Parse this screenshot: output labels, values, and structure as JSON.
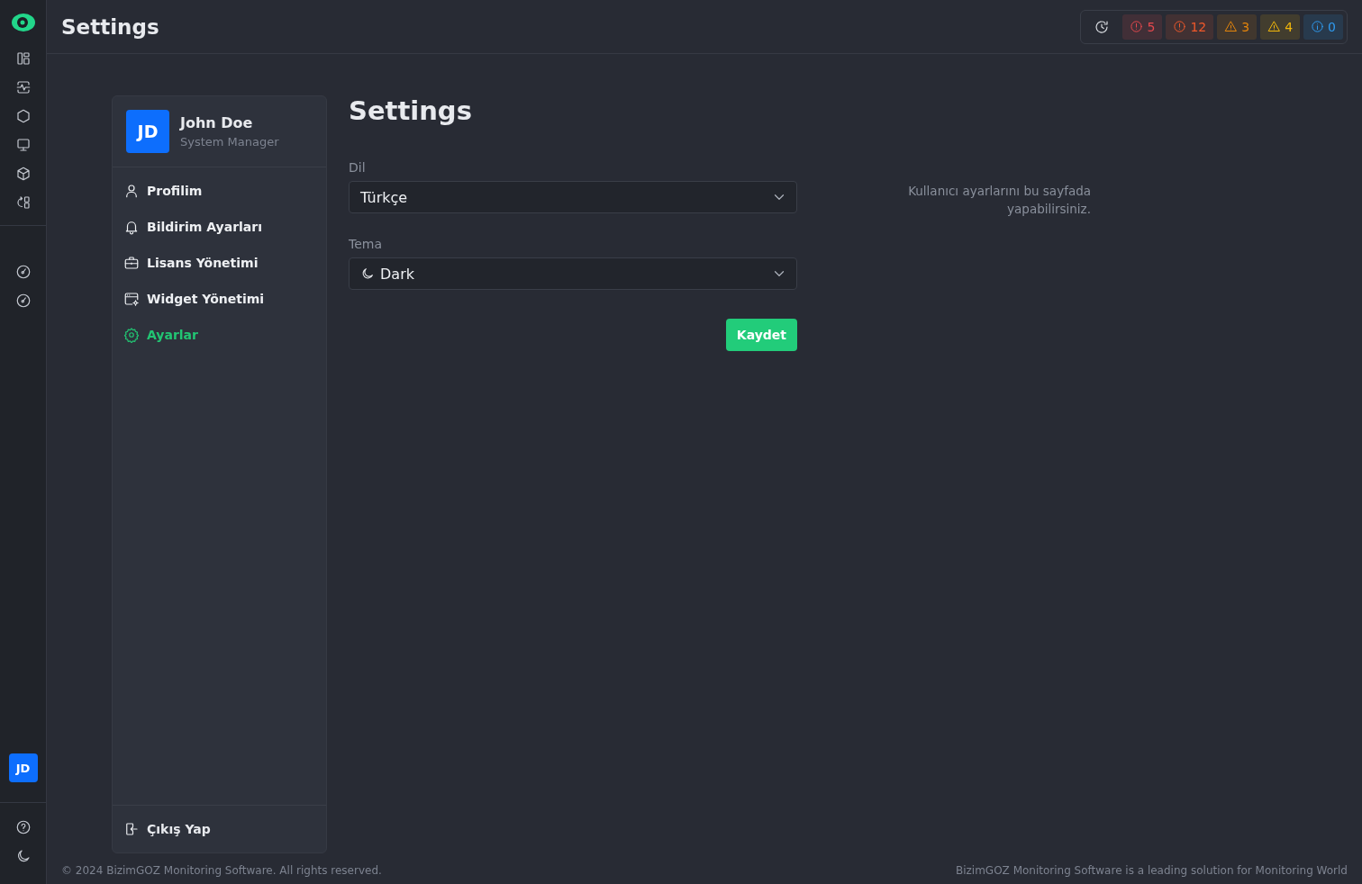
{
  "header": {
    "title": "Settings"
  },
  "alerts": [
    {
      "kind": "error",
      "count": "5",
      "color": "#e5484d"
    },
    {
      "kind": "error",
      "count": "12",
      "color": "#f0582a"
    },
    {
      "kind": "warning",
      "count": "3",
      "color": "#e5850b"
    },
    {
      "kind": "warning",
      "count": "4",
      "color": "#f2b70a"
    },
    {
      "kind": "info",
      "count": "0",
      "color": "#2f9bf0"
    }
  ],
  "rail": {
    "avatar": "JD"
  },
  "profile": {
    "initials": "JD",
    "name": "John Doe",
    "role": "System Manager"
  },
  "menu": [
    {
      "kind": "user",
      "label": "Profilim",
      "selected": false
    },
    {
      "kind": "bell",
      "label": "Bildirim Ayarları",
      "selected": false
    },
    {
      "kind": "briefcase",
      "label": "Lisans Yönetimi",
      "selected": false
    },
    {
      "kind": "widget",
      "label": "Widget Yönetimi",
      "selected": false
    },
    {
      "kind": "gear",
      "label": "Ayarlar",
      "selected": true
    }
  ],
  "logout": "Çıkış Yap",
  "form": {
    "title": "Settings",
    "fields": [
      {
        "label": "Dil",
        "value": "Türkçe",
        "kind": "plain"
      },
      {
        "label": "Tema",
        "value": "Dark",
        "kind": "moon"
      }
    ],
    "save": "Kaydet",
    "hint": "Kullanıcı ayarlarını bu sayfada yapabilirsiniz."
  },
  "footer": {
    "left": "© 2024 BizimGOZ Monitoring Software. All rights reserved.",
    "right": "BizimGOZ Monitoring Software is a leading solution for Monitoring World"
  }
}
